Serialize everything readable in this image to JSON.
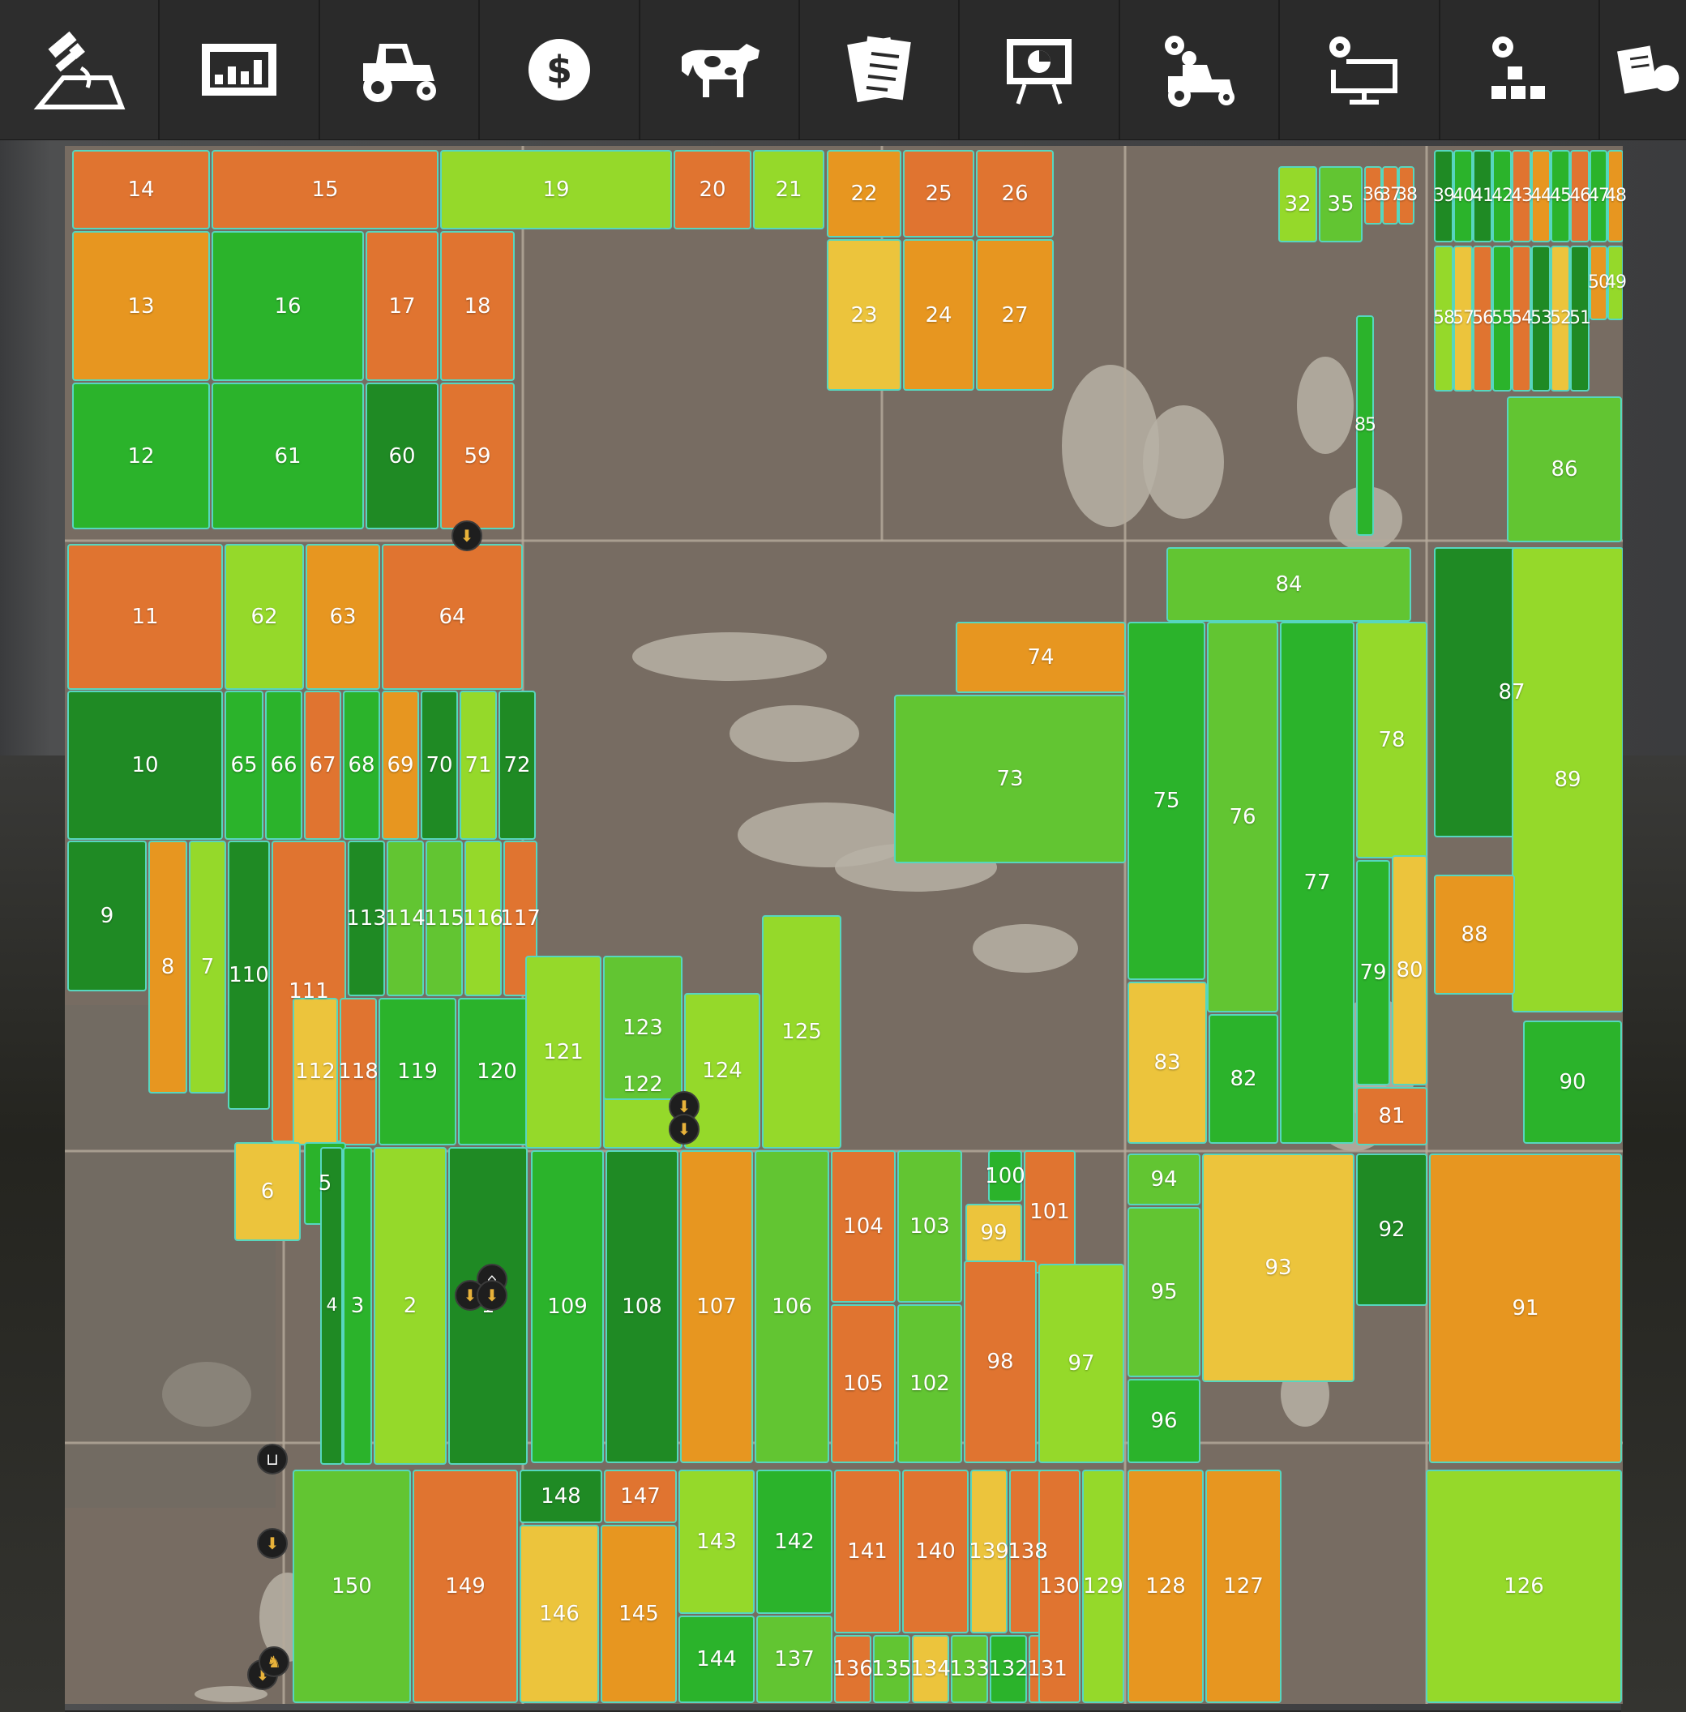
{
  "toolbar": {
    "tabs": [
      {
        "name": "map-tab",
        "icon": "satellite-map-icon",
        "active": true
      },
      {
        "name": "statistics-tab",
        "icon": "bar-chart-icon"
      },
      {
        "name": "vehicles-tab",
        "icon": "tractor-icon"
      },
      {
        "name": "finances-tab",
        "icon": "dollar-icon"
      },
      {
        "name": "animals-tab",
        "icon": "cow-icon"
      },
      {
        "name": "contracts-tab",
        "icon": "documents-icon"
      },
      {
        "name": "tour-tab",
        "icon": "presentation-icon"
      },
      {
        "name": "vehicle-settings-tab",
        "icon": "tractor-gear-icon"
      },
      {
        "name": "general-settings-tab",
        "icon": "monitor-gear-icon"
      },
      {
        "name": "production-tab",
        "icon": "blocks-gear-icon"
      },
      {
        "name": "help-tab",
        "icon": "document-partial-icon"
      }
    ]
  },
  "map": {
    "colors": {
      "dark_green": "#1f8a24",
      "green": "#2bb32b",
      "mid_green": "#62c532",
      "lime": "#95d92a",
      "yellow": "#ecc43c",
      "light_orange": "#e79620",
      "orange": "#e07430",
      "terrain": "#776c62",
      "terrain_light": "#b7b2a6",
      "border": "#57d6bf"
    },
    "fields": [
      {
        "id": "14",
        "c": "orange"
      },
      {
        "id": "15",
        "c": "orange"
      },
      {
        "id": "19",
        "c": "lime"
      },
      {
        "id": "20",
        "c": "orange"
      },
      {
        "id": "21",
        "c": "lime"
      },
      {
        "id": "22",
        "c": "light_orange"
      },
      {
        "id": "25",
        "c": "orange"
      },
      {
        "id": "26",
        "c": "orange"
      },
      {
        "id": "13",
        "c": "light_orange"
      },
      {
        "id": "16",
        "c": "green"
      },
      {
        "id": "17",
        "c": "orange"
      },
      {
        "id": "18",
        "c": "orange"
      },
      {
        "id": "23",
        "c": "yellow"
      },
      {
        "id": "24",
        "c": "light_orange"
      },
      {
        "id": "27",
        "c": "light_orange"
      },
      {
        "id": "12",
        "c": "green"
      },
      {
        "id": "61",
        "c": "green"
      },
      {
        "id": "60",
        "c": "dark_green"
      },
      {
        "id": "59",
        "c": "orange"
      },
      {
        "id": "32",
        "c": "lime"
      },
      {
        "id": "35",
        "c": "mid_green"
      },
      {
        "id": "36",
        "c": "orange"
      },
      {
        "id": "37",
        "c": "orange"
      },
      {
        "id": "38",
        "c": "orange"
      },
      {
        "id": "39",
        "c": "dark_green"
      },
      {
        "id": "40",
        "c": "green"
      },
      {
        "id": "41",
        "c": "dark_green"
      },
      {
        "id": "42",
        "c": "green"
      },
      {
        "id": "43",
        "c": "orange"
      },
      {
        "id": "44",
        "c": "light_orange"
      },
      {
        "id": "45",
        "c": "green"
      },
      {
        "id": "46",
        "c": "orange"
      },
      {
        "id": "47",
        "c": "green"
      },
      {
        "id": "48",
        "c": "light_orange"
      },
      {
        "id": "58",
        "c": "lime"
      },
      {
        "id": "57",
        "c": "yellow"
      },
      {
        "id": "56",
        "c": "orange"
      },
      {
        "id": "55",
        "c": "green"
      },
      {
        "id": "54",
        "c": "orange"
      },
      {
        "id": "53",
        "c": "dark_green"
      },
      {
        "id": "52",
        "c": "yellow"
      },
      {
        "id": "51",
        "c": "dark_green"
      },
      {
        "id": "50",
        "c": "light_orange"
      },
      {
        "id": "49",
        "c": "lime"
      },
      {
        "id": "85",
        "c": "green"
      },
      {
        "id": "86",
        "c": "mid_green"
      },
      {
        "id": "11",
        "c": "orange"
      },
      {
        "id": "62",
        "c": "lime"
      },
      {
        "id": "63",
        "c": "light_orange"
      },
      {
        "id": "64",
        "c": "orange"
      },
      {
        "id": "10",
        "c": "dark_green"
      },
      {
        "id": "65",
        "c": "green"
      },
      {
        "id": "66",
        "c": "green"
      },
      {
        "id": "67",
        "c": "orange"
      },
      {
        "id": "68",
        "c": "green"
      },
      {
        "id": "69",
        "c": "light_orange"
      },
      {
        "id": "70",
        "c": "dark_green"
      },
      {
        "id": "71",
        "c": "lime"
      },
      {
        "id": "72",
        "c": "dark_green"
      },
      {
        "id": "9",
        "c": "dark_green"
      },
      {
        "id": "8",
        "c": "light_orange"
      },
      {
        "id": "7",
        "c": "lime"
      },
      {
        "id": "110",
        "c": "dark_green"
      },
      {
        "id": "111",
        "c": "orange"
      },
      {
        "id": "113",
        "c": "dark_green"
      },
      {
        "id": "114",
        "c": "mid_green"
      },
      {
        "id": "115",
        "c": "mid_green"
      },
      {
        "id": "116",
        "c": "lime"
      },
      {
        "id": "117",
        "c": "orange"
      },
      {
        "id": "112",
        "c": "yellow"
      },
      {
        "id": "118",
        "c": "orange"
      },
      {
        "id": "119",
        "c": "green"
      },
      {
        "id": "120",
        "c": "green"
      },
      {
        "id": "121",
        "c": "lime"
      },
      {
        "id": "122",
        "c": "lime"
      },
      {
        "id": "123",
        "c": "mid_green"
      },
      {
        "id": "124",
        "c": "lime"
      },
      {
        "id": "125",
        "c": "lime"
      },
      {
        "id": "84",
        "c": "mid_green"
      },
      {
        "id": "74",
        "c": "light_orange"
      },
      {
        "id": "73",
        "c": "mid_green"
      },
      {
        "id": "75",
        "c": "green"
      },
      {
        "id": "76",
        "c": "mid_green"
      },
      {
        "id": "77",
        "c": "green"
      },
      {
        "id": "78",
        "c": "lime"
      },
      {
        "id": "87",
        "c": "dark_green"
      },
      {
        "id": "89",
        "c": "lime"
      },
      {
        "id": "79",
        "c": "green"
      },
      {
        "id": "80",
        "c": "yellow"
      },
      {
        "id": "88",
        "c": "light_orange"
      },
      {
        "id": "83",
        "c": "yellow"
      },
      {
        "id": "82",
        "c": "green"
      },
      {
        "id": "81",
        "c": "orange"
      },
      {
        "id": "90",
        "c": "green"
      },
      {
        "id": "6",
        "c": "yellow"
      },
      {
        "id": "5",
        "c": "green"
      },
      {
        "id": "4",
        "c": "dark_green"
      },
      {
        "id": "3",
        "c": "green"
      },
      {
        "id": "2",
        "c": "lime"
      },
      {
        "id": "1",
        "c": "dark_green"
      },
      {
        "id": "109",
        "c": "green"
      },
      {
        "id": "108",
        "c": "dark_green"
      },
      {
        "id": "107",
        "c": "light_orange"
      },
      {
        "id": "106",
        "c": "mid_green"
      },
      {
        "id": "104",
        "c": "orange"
      },
      {
        "id": "103",
        "c": "mid_green"
      },
      {
        "id": "105",
        "c": "orange"
      },
      {
        "id": "102",
        "c": "mid_green"
      },
      {
        "id": "100",
        "c": "green"
      },
      {
        "id": "99",
        "c": "yellow"
      },
      {
        "id": "101",
        "c": "orange"
      },
      {
        "id": "98",
        "c": "orange"
      },
      {
        "id": "97",
        "c": "lime"
      },
      {
        "id": "94",
        "c": "mid_green"
      },
      {
        "id": "95",
        "c": "mid_green"
      },
      {
        "id": "96",
        "c": "green"
      },
      {
        "id": "93",
        "c": "yellow"
      },
      {
        "id": "92",
        "c": "dark_green"
      },
      {
        "id": "91",
        "c": "light_orange"
      },
      {
        "id": "150",
        "c": "mid_green"
      },
      {
        "id": "149",
        "c": "orange"
      },
      {
        "id": "148",
        "c": "dark_green"
      },
      {
        "id": "147",
        "c": "orange"
      },
      {
        "id": "146",
        "c": "yellow"
      },
      {
        "id": "145",
        "c": "light_orange"
      },
      {
        "id": "143",
        "c": "lime"
      },
      {
        "id": "142",
        "c": "green"
      },
      {
        "id": "144",
        "c": "green"
      },
      {
        "id": "137",
        "c": "mid_green"
      },
      {
        "id": "141",
        "c": "orange"
      },
      {
        "id": "140",
        "c": "orange"
      },
      {
        "id": "139",
        "c": "yellow"
      },
      {
        "id": "138",
        "c": "orange"
      },
      {
        "id": "136",
        "c": "orange"
      },
      {
        "id": "135",
        "c": "mid_green"
      },
      {
        "id": "134",
        "c": "yellow"
      },
      {
        "id": "133",
        "c": "mid_green"
      },
      {
        "id": "132",
        "c": "green"
      },
      {
        "id": "131",
        "c": "orange"
      },
      {
        "id": "130",
        "c": "orange"
      },
      {
        "id": "129",
        "c": "lime"
      },
      {
        "id": "128",
        "c": "light_orange"
      },
      {
        "id": "127",
        "c": "light_orange"
      },
      {
        "id": "126",
        "c": "lime"
      }
    ],
    "pois": [
      {
        "name": "sell-point-icon"
      },
      {
        "name": "sell-point-icon"
      },
      {
        "name": "sell-point-icon"
      },
      {
        "name": "farm-house-icon"
      },
      {
        "name": "sell-point-icon"
      },
      {
        "name": "sell-point-icon"
      },
      {
        "name": "shop-basket-icon"
      },
      {
        "name": "sell-point-icon"
      },
      {
        "name": "sell-point-icon"
      },
      {
        "name": "animal-dealer-icon"
      }
    ]
  }
}
